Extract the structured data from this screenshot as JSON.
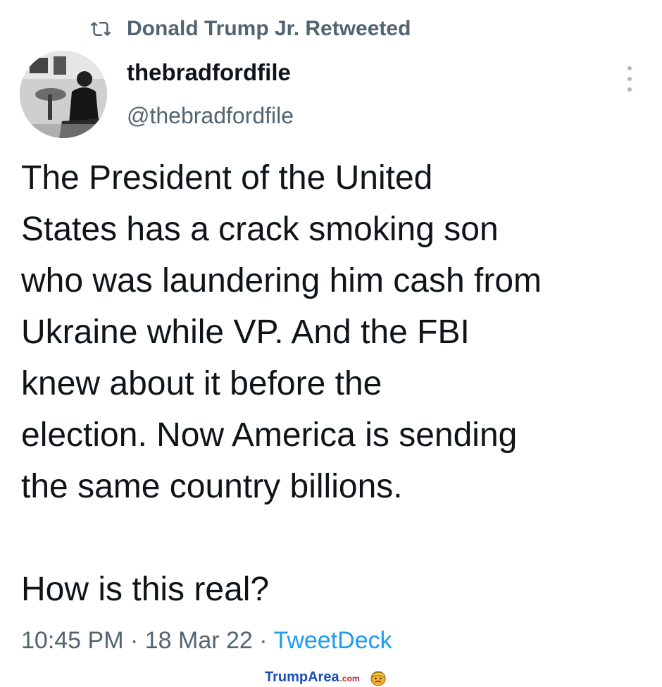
{
  "retweet": {
    "icon": "retweet-icon",
    "text": "Donald Trump Jr. Retweeted"
  },
  "author": {
    "display_name": "thebradfordfile",
    "handle": "@thebradfordfile",
    "avatar": "avatar-photo"
  },
  "menu": {
    "icon": "more-options-icon"
  },
  "tweet": {
    "paragraph1": "The President of the United\nStates has a crack smoking son\nwho was laundering him cash from\nUkraine while VP. And the FBI\nknew about it  before the\nelection. Now America is sending\nthe same country billions.",
    "paragraph2": "How is this real?"
  },
  "meta": {
    "time": "10:45 PM",
    "sep1": " · ",
    "date": "18 Mar 22",
    "sep2": " · ",
    "source": "TweetDeck"
  },
  "watermark": {
    "brand": "TrumpArea",
    "tld": ".com",
    "icon": "trump-face-icon"
  },
  "colors": {
    "text": "#0f1419",
    "secondary": "#536471",
    "link": "#1d9bf0",
    "watermark_blue": "#1a4db8",
    "watermark_red": "#c0252a"
  }
}
